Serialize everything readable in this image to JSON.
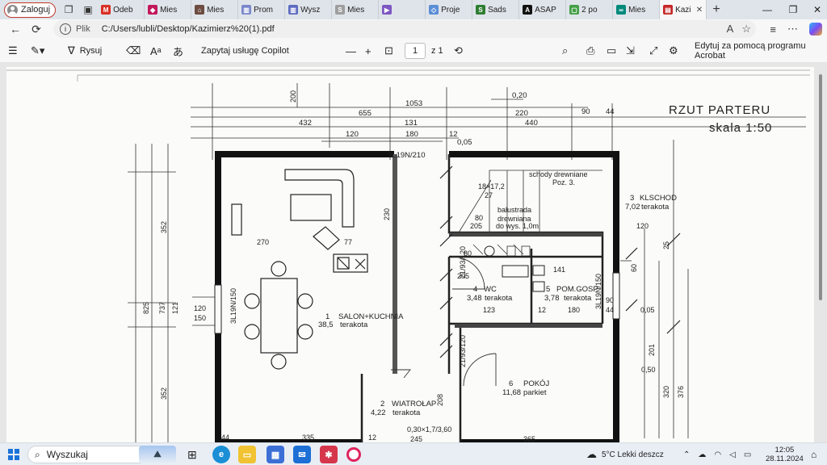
{
  "browser": {
    "profile_label": "Zaloguj",
    "tabs": [
      {
        "label": "Odeb",
        "fav_color": "#d93025",
        "fav_glyph": "M"
      },
      {
        "label": "Mies",
        "fav_color": "#c2185b",
        "fav_glyph": "◆"
      },
      {
        "label": "Mies",
        "fav_color": "#6d4c41",
        "fav_glyph": "⌂"
      },
      {
        "label": "Prom",
        "fav_color": "#7986cb",
        "fav_glyph": "▥"
      },
      {
        "label": "Wysz",
        "fav_color": "#5c6bc0",
        "fav_glyph": "▥"
      },
      {
        "label": "Mies",
        "fav_color": "#9e9e9e",
        "fav_glyph": "S"
      },
      {
        "label": "",
        "fav_color": "#7e57c2",
        "fav_glyph": "▶"
      },
      {
        "label": "Proje",
        "fav_color": "#5c8fd6",
        "fav_glyph": "◇"
      },
      {
        "label": "Sads",
        "fav_color": "#2e7d32",
        "fav_glyph": "S"
      },
      {
        "label": "ASAP",
        "fav_color": "#111111",
        "fav_glyph": "A"
      },
      {
        "label": "2 po",
        "fav_color": "#43a047",
        "fav_glyph": "▢"
      },
      {
        "label": "Mies",
        "fav_color": "#00897b",
        "fav_glyph": "∞"
      },
      {
        "label": "Kazi",
        "fav_color": "#c62828",
        "fav_glyph": "▤",
        "active": true
      }
    ],
    "url_scheme": "Plik",
    "url_path": "C:/Users/lubli/Desktop/Kazimierz%20(1).pdf"
  },
  "pdf_toolbar": {
    "draw_label": "Rysuj",
    "copilot_label": "Zapytaj usługę Copilot",
    "page_current": "1",
    "page_total": "z 1",
    "edit_acrobat_label": "Edytuj za pomocą programu Acrobat"
  },
  "plan": {
    "title_line1": "RZUT PARTERU",
    "title_line2": "skala 1:50",
    "dims_top": [
      "0,20",
      "1053",
      "200",
      "655",
      "432",
      "220",
      "90",
      "44",
      "440",
      "131",
      "120",
      "180",
      "0,05",
      "12",
      "3L19N/210"
    ],
    "rooms": [
      {
        "no": "1",
        "name": "SALON+KUCHNIA",
        "area": "38,5",
        "floor": "terakota"
      },
      {
        "no": "2",
        "name": "WIATROŁAP",
        "area": "4,22",
        "floor": "terakota"
      },
      {
        "no": "3",
        "name": "KLSCHOD",
        "area": "7,02",
        "floor": "terakota"
      },
      {
        "no": "4",
        "name": "WC",
        "area": "3,48",
        "floor": "terakota"
      },
      {
        "no": "5",
        "name": "POM.GOSP",
        "area": "3,78",
        "floor": "terakota"
      },
      {
        "no": "6",
        "name": "POKÓJ",
        "area": "11,68",
        "floor": "parkiet"
      }
    ],
    "stairs_label": "schody drewniane",
    "stairs_level": "Poz. 3.",
    "stairs_dim1": "18×17,2",
    "stairs_dim2": "27",
    "balustrade": "balustrada",
    "balustrade2": "drewniana",
    "balustrade3": "do wys. 1,0m",
    "dim_2705": "270",
    "dim_77": "77",
    "dim_120_150": "120",
    "dim_150": "150",
    "dim_3355": "335",
    "dim_365": "365",
    "dim_bottom_44": "44",
    "dim_bottom_12": "12",
    "dim_825": "825",
    "dim_737": "737",
    "dim_352a": "352",
    "dim_121": "121",
    "dim_352b": "352",
    "window_left": "3L19N/150",
    "window_right": "3L19N/150",
    "door_wc": "21/93/120",
    "door_pokoj": "21/93/120",
    "dim_wc_80": "80",
    "dim_wc_205": "205",
    "dim_141": "141",
    "dim_123": "123",
    "dim_180": "180",
    "dim_12": "12",
    "dim_90": "90",
    "dim_205": "205",
    "dim_25": "25",
    "dim_44": "44",
    "dim_005": "0,05",
    "dim_050": "0,50",
    "dim_320": "320",
    "dim_376": "376",
    "dim_208": "208",
    "dim_230": "230",
    "dim_80": "80",
    "dim_bottom_300": "0,30×1,7/3,60",
    "dim_245": "245",
    "dim_120r": "120",
    "dim_60": "60",
    "dim_201": "201"
  },
  "taskbar": {
    "search_label": "Wyszukaj",
    "weather": "5°C  Lekki deszcz",
    "time": "12:05",
    "date": "28.11.2024"
  },
  "colors": {
    "accent": "#1a73d9",
    "profile_border": "#c0392b",
    "tab_strip": "#dfe4ea"
  }
}
